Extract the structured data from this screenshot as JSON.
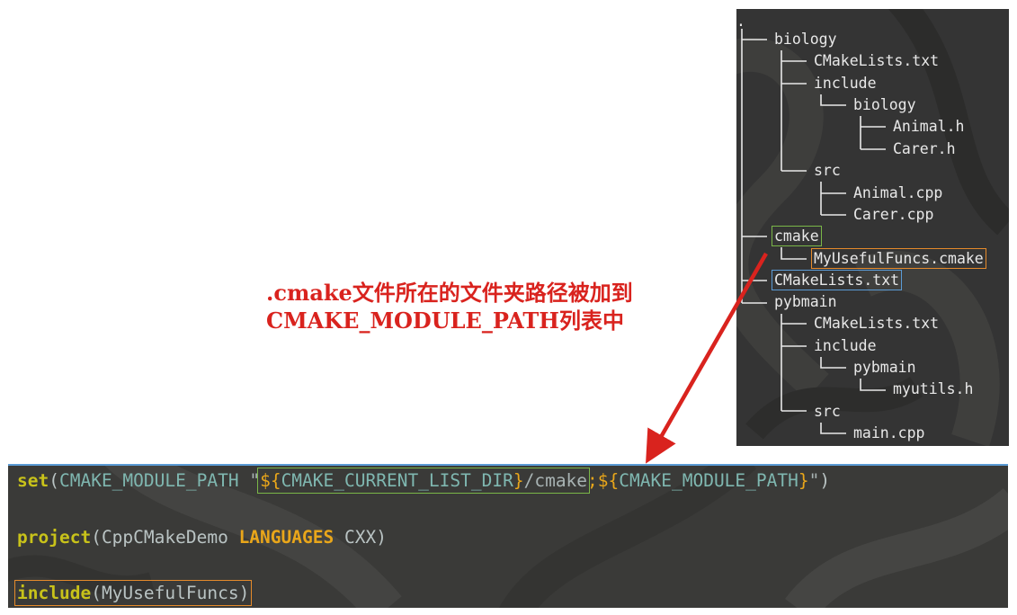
{
  "tree": {
    "root": ".",
    "items": [
      {
        "label": "biology"
      },
      {
        "label": "CMakeLists.txt"
      },
      {
        "label": "include"
      },
      {
        "label": "biology"
      },
      {
        "label": "Animal.h"
      },
      {
        "label": "Carer.h"
      },
      {
        "label": "src"
      },
      {
        "label": "Animal.cpp"
      },
      {
        "label": "Carer.cpp"
      },
      {
        "label": "cmake"
      },
      {
        "label": "MyUsefulFuncs.cmake"
      },
      {
        "label": "CMakeLists.txt"
      },
      {
        "label": "pybmain"
      },
      {
        "label": "CMakeLists.txt"
      },
      {
        "label": "include"
      },
      {
        "label": "pybmain"
      },
      {
        "label": "myutils.h"
      },
      {
        "label": "src"
      },
      {
        "label": "main.cpp"
      }
    ]
  },
  "annotation": {
    "line1": ".cmake文件所在的文件夹路径被加到",
    "line2": "CMAKE_MODULE_PATH列表中"
  },
  "code": {
    "line1": {
      "cmd": "set",
      "open": "(",
      "var": "CMAKE_MODULE_PATH",
      "space": " ",
      "quote_open": "\"",
      "dollar1": "${",
      "var2": "CMAKE_CURRENT_LIST_DIR",
      "close1": "}",
      "path": "/cmake",
      "sep": ";",
      "dollar2": "${",
      "var3": "CMAKE_MODULE_PATH",
      "close2": "}",
      "quote_close": "\"",
      "close": ")"
    },
    "line2": {
      "cmd": "project",
      "open": "(",
      "name": "CppCMakeDemo ",
      "kw": "LANGUAGES",
      "lang": " CXX",
      "close": ")"
    },
    "line3": {
      "cmd": "include",
      "open": "(",
      "arg": "MyUsefulFuncs",
      "close": ")"
    }
  },
  "colors": {
    "annotation": "#d9231e",
    "highlight_green": "#7ab648",
    "highlight_orange": "#e58a2b",
    "highlight_blue": "#5b9bd5"
  }
}
